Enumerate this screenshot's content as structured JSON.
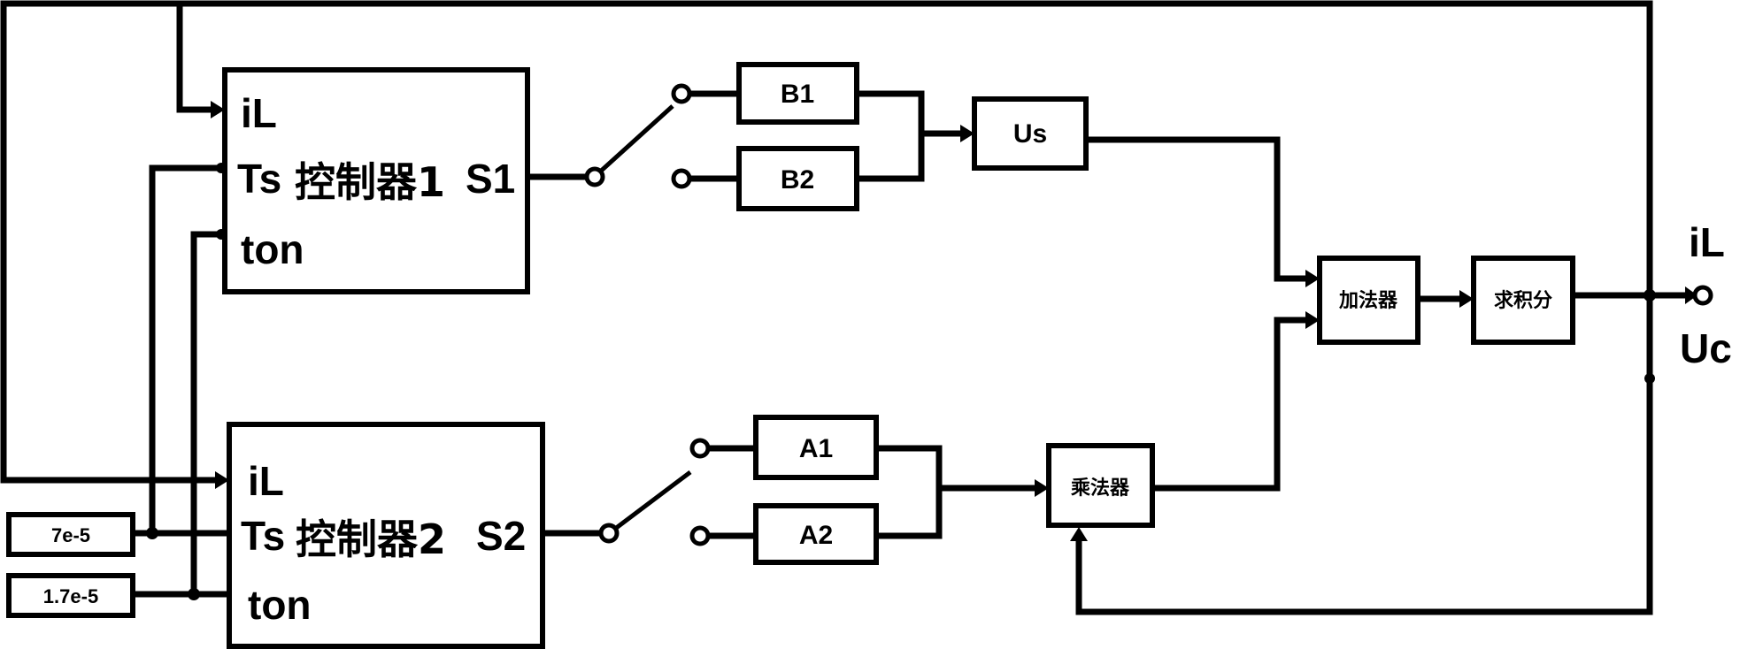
{
  "diagram": {
    "controllers": [
      {
        "id": "controller1",
        "inputs": [
          "iL",
          "Ts",
          "ton"
        ],
        "name": "控制器1",
        "output": "S1"
      },
      {
        "id": "controller2",
        "inputs": [
          "iL",
          "Ts",
          "ton"
        ],
        "name": "控制器2",
        "output": "S2"
      }
    ],
    "constants": [
      {
        "id": "ts-constant",
        "value": "7e-5"
      },
      {
        "id": "ton-constant",
        "value": "1.7e-5"
      }
    ],
    "blocks": {
      "b1": "B1",
      "b2": "B2",
      "us": "Us",
      "a1": "A1",
      "a2": "A2",
      "multiplier": "乘法器",
      "adder": "加法器",
      "integrator": "求积分"
    },
    "outputs": {
      "top_label": "iL",
      "bottom_label": "Uc"
    }
  }
}
